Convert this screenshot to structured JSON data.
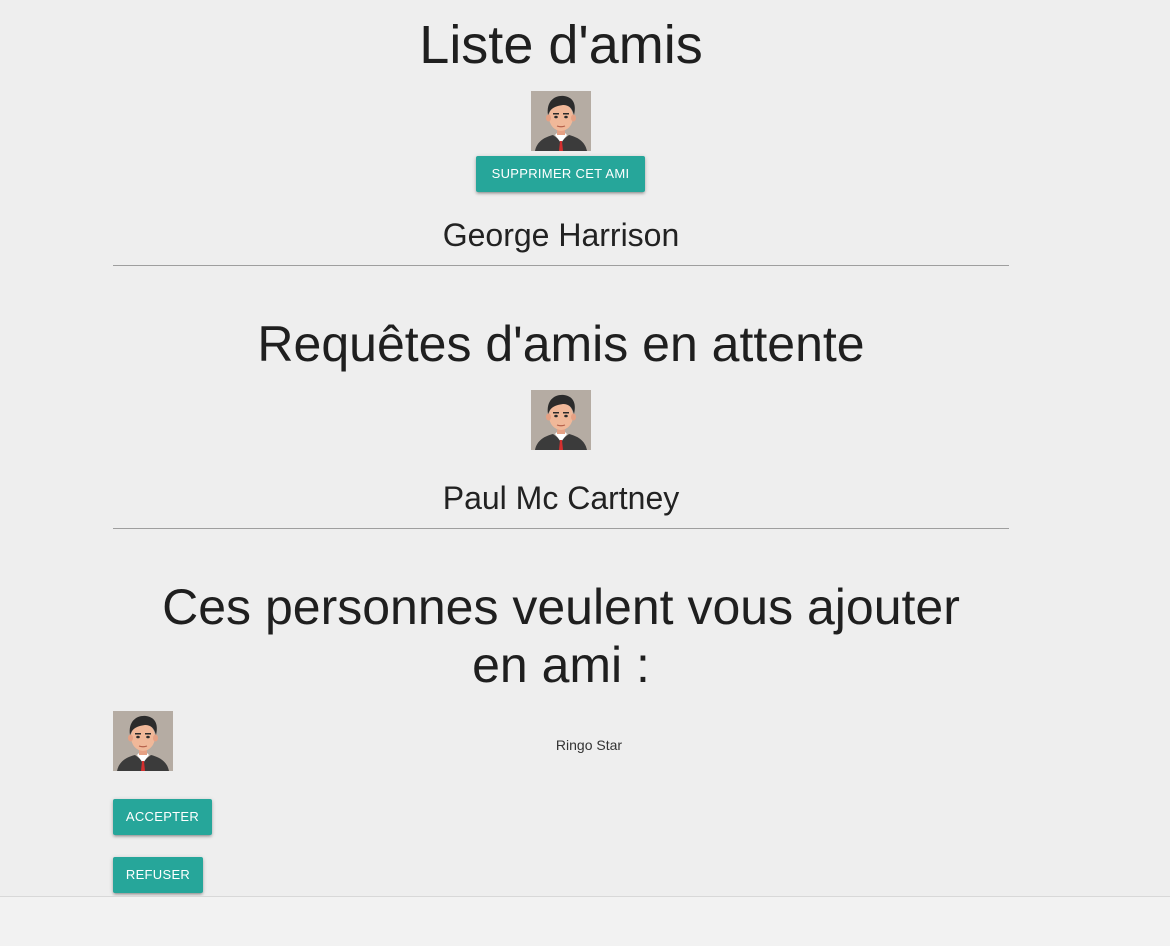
{
  "friends_section": {
    "title": "Liste d'amis",
    "friend": {
      "name": "George Harrison",
      "remove_button": "SUPPRIMER CET AMI"
    }
  },
  "pending_section": {
    "title": "Requêtes d'amis en attente",
    "request": {
      "name": "Paul Mc Cartney"
    }
  },
  "incoming_section": {
    "title_line1": "Ces personnes veulent vous ajouter",
    "title_line2": "en ami :",
    "request": {
      "name": "Ringo Star",
      "accept_button": "ACCEPTER",
      "refuse_button": "REFUSER"
    }
  },
  "colors": {
    "accent": "#26a69a",
    "background": "#eeeeee"
  }
}
